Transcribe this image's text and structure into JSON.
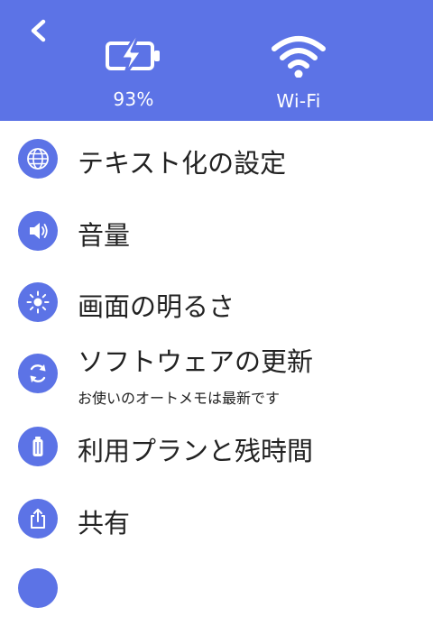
{
  "header": {
    "battery_label": "93%",
    "wifi_label": "Wi-Fi",
    "accent": "#5c73e6"
  },
  "menu": {
    "items": [
      {
        "label": "テキスト化の設定",
        "icon": "globe-icon"
      },
      {
        "label": "音量",
        "icon": "speaker-icon"
      },
      {
        "label": "画面の明るさ",
        "icon": "brightness-icon"
      },
      {
        "label": "ソフトウェアの更新",
        "sublabel": "お使いのオートメモは最新です",
        "icon": "refresh-icon"
      },
      {
        "label": "利用プランと残時間",
        "icon": "battery-plan-icon"
      },
      {
        "label": "共有",
        "icon": "share-icon"
      }
    ]
  }
}
